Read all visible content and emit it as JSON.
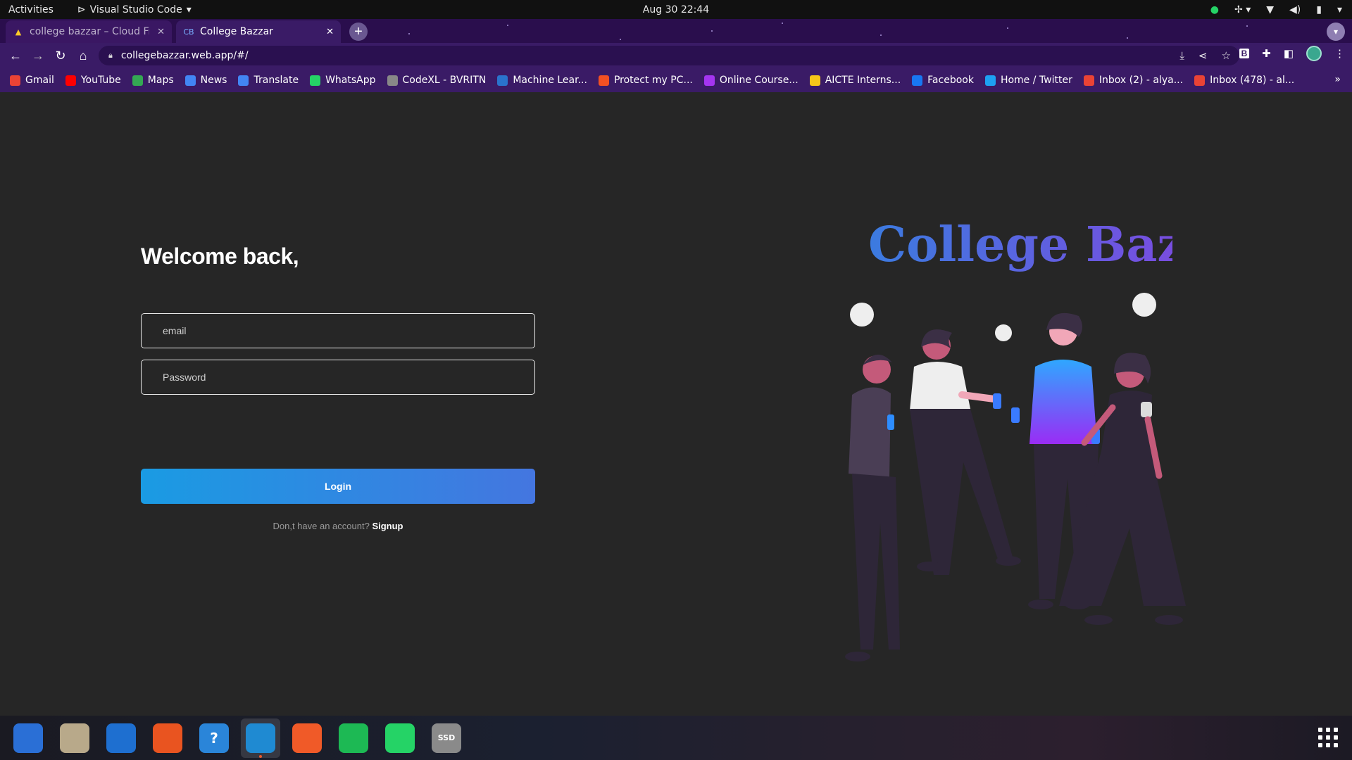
{
  "topbar": {
    "activities": "Activities",
    "app_name": "Visual Studio Code",
    "clock": "Aug 30  22:44"
  },
  "tabs": [
    {
      "title": "college bazzar – Cloud Fir",
      "active": false
    },
    {
      "title": "College Bazzar",
      "active": true
    }
  ],
  "address_bar": {
    "url": "collegebazzar.web.app/#/"
  },
  "bookmarks": [
    {
      "label": "Gmail",
      "icon": "gmail-icon",
      "color": "#ea4335"
    },
    {
      "label": "YouTube",
      "icon": "youtube-icon",
      "color": "#ff0000"
    },
    {
      "label": "Maps",
      "icon": "maps-icon",
      "color": "#34a853"
    },
    {
      "label": "News",
      "icon": "news-icon",
      "color": "#4285f4"
    },
    {
      "label": "Translate",
      "icon": "translate-icon",
      "color": "#4285f4"
    },
    {
      "label": "WhatsApp",
      "icon": "whatsapp-icon",
      "color": "#25d366"
    },
    {
      "label": "CodeXL - BVRITN",
      "icon": "globe-icon",
      "color": "#888888"
    },
    {
      "label": "Machine Lear...",
      "icon": "coursera-icon",
      "color": "#2a73cc"
    },
    {
      "label": "Protect my PC...",
      "icon": "microsoft-icon",
      "color": "#f25022"
    },
    {
      "label": "Online Course...",
      "icon": "udemy-icon",
      "color": "#a435f0"
    },
    {
      "label": "AICTE Interns...",
      "icon": "aicte-icon",
      "color": "#f5c518"
    },
    {
      "label": "Facebook",
      "icon": "facebook-icon",
      "color": "#1877f2"
    },
    {
      "label": "Home / Twitter",
      "icon": "twitter-icon",
      "color": "#1da1f2"
    },
    {
      "label": "Inbox (2) - alya...",
      "icon": "gmail-icon",
      "color": "#ea4335"
    },
    {
      "label": "Inbox (478) - al...",
      "icon": "gmail-icon",
      "color": "#ea4335"
    }
  ],
  "login": {
    "heading": "Welcome back,",
    "email_placeholder": "email",
    "password_placeholder": "Password",
    "login_label": "Login",
    "no_account_text": "Don,t have an account?",
    "signup_label": "Signup"
  },
  "brand": {
    "logo_text": "College Bazzar",
    "gradient_start": "#3b7be0",
    "gradient_end": "#8b3fe0"
  },
  "dock": [
    {
      "name": "thunderbird-icon",
      "color": "#2a6fd6"
    },
    {
      "name": "files-icon",
      "color": "#b8a98a"
    },
    {
      "name": "writer-icon",
      "color": "#1e6fd0"
    },
    {
      "name": "app-center-icon",
      "color": "#e95420"
    },
    {
      "name": "help-icon",
      "color": "#2a85d9",
      "glyph": "?"
    },
    {
      "name": "vscode-icon",
      "color": "#1f8ad2",
      "active": true
    },
    {
      "name": "brave-icon",
      "color": "#f05a28"
    },
    {
      "name": "spotify-icon",
      "color": "#1db954"
    },
    {
      "name": "whatsapp-icon",
      "color": "#25d366"
    },
    {
      "name": "ssd-drive-icon",
      "color": "#8a8a8a",
      "glyph": "SSD"
    }
  ]
}
